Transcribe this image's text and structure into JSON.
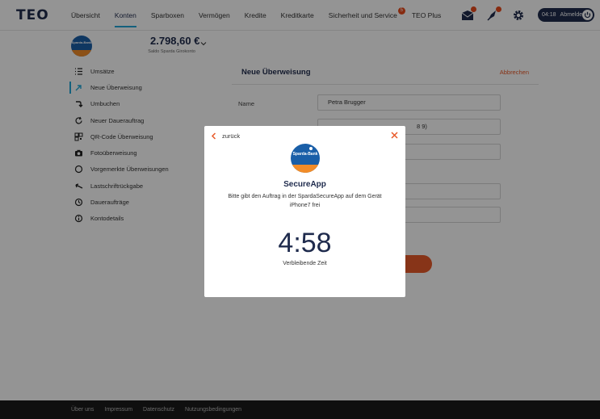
{
  "header": {
    "logo": "TEO",
    "nav": [
      {
        "label": "Übersicht",
        "active": false
      },
      {
        "label": "Konten",
        "active": true
      },
      {
        "label": "Sparboxen",
        "active": false
      },
      {
        "label": "Vermögen",
        "active": false
      },
      {
        "label": "Kredite",
        "active": false
      },
      {
        "label": "Kreditkarte",
        "active": false
      },
      {
        "label": "Sicherheit und Service",
        "active": false,
        "badge": "5"
      },
      {
        "label": "TEO Plus",
        "active": false
      }
    ],
    "session_time": "04:18",
    "logout_label": "Abmelden"
  },
  "account": {
    "bank_logo_text": "Sparda-Bank",
    "balance": "2.798,60 €",
    "subtitle": "Saldo Sparda Girokonto"
  },
  "sidebar": {
    "items": [
      {
        "label": "Umsätze",
        "icon": "list-icon"
      },
      {
        "label": "Neue Überweisung",
        "icon": "transfer-arrow-icon",
        "active": true
      },
      {
        "label": "Umbuchen",
        "icon": "rebook-icon"
      },
      {
        "label": "Neuer Dauerauftrag",
        "icon": "recurring-icon"
      },
      {
        "label": "QR-Code Überweisung",
        "icon": "qr-code-icon"
      },
      {
        "label": "Fotoüberweisung",
        "icon": "camera-icon"
      },
      {
        "label": "Vorgemerkte Überweisungen",
        "icon": "pending-icon"
      },
      {
        "label": "Lastschriftrückgabe",
        "icon": "return-arrow-icon"
      },
      {
        "label": "Daueraufträge",
        "icon": "clock-icon"
      },
      {
        "label": "Kontodetails",
        "icon": "info-icon"
      }
    ]
  },
  "form": {
    "title": "Neue Überweisung",
    "cancel": "Abbrechen",
    "name_label": "Name",
    "name_value": "Petra Brugger",
    "iban_partial": "8 9)"
  },
  "modal": {
    "back": "zurück",
    "logo_text": "Sparda-Bank",
    "title": "SecureApp",
    "text": "Bitte gibt den Auftrag in der SpardaSecureApp auf dem Gerät iPhone7 frei",
    "timer": "4:58",
    "timer_label": "Verbleibende Zeit"
  },
  "footer": {
    "links": [
      "Über uns",
      "Impressum",
      "Datenschutz",
      "Nutzungsbedingungen"
    ]
  },
  "colors": {
    "brand_navy": "#1f2b4d",
    "accent_blue": "#23a7d8",
    "accent_orange": "#e85a2a",
    "sparda_blue": "#1a5fa8",
    "sparda_orange": "#f28c28"
  }
}
